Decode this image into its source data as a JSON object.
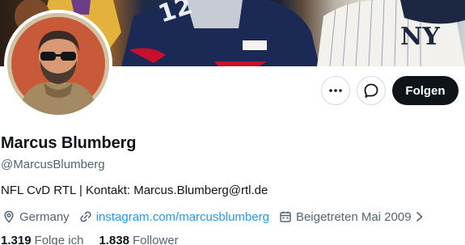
{
  "profile": {
    "name": "Marcus Blumberg",
    "handle": "@MarcusBlumberg",
    "bio": "NFL CvD RTL | Kontakt: Marcus.Blumberg@rtl.de",
    "location": "Germany",
    "website": "instagram.com/marcusblumberg",
    "joined": "Beigetreten Mai 2009"
  },
  "stats": {
    "following_count": "1.319",
    "following_label": "Folge ich",
    "followers_count": "1.838",
    "followers_label": "Follower"
  },
  "actions": {
    "more_icon": "more-dots-icon",
    "message_icon": "message-icon",
    "follow_label": "Folgen"
  },
  "icons": {
    "location": "location-pin-icon",
    "link": "link-icon",
    "calendar": "calendar-icon",
    "chevron": "chevron-right-icon"
  },
  "colors": {
    "text": "#0f1419",
    "secondary": "#536471",
    "link": "#1d9bf0",
    "button_dark": "#0f1419",
    "border": "#cfd9de"
  }
}
